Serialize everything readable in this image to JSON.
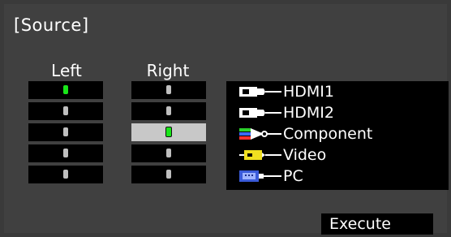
{
  "header": {
    "title": "[Source]"
  },
  "columns": {
    "left_label": "Left",
    "right_label": "Right"
  },
  "left_rows": [
    {
      "active": true,
      "selected": false
    },
    {
      "active": false,
      "selected": false
    },
    {
      "active": false,
      "selected": false
    },
    {
      "active": false,
      "selected": false
    },
    {
      "active": false,
      "selected": false
    }
  ],
  "right_rows": [
    {
      "active": false,
      "selected": false
    },
    {
      "active": false,
      "selected": false
    },
    {
      "active": true,
      "selected": true
    },
    {
      "active": false,
      "selected": false
    },
    {
      "active": false,
      "selected": false
    }
  ],
  "sources": [
    {
      "label": "HDMI1",
      "icon": "hdmi-cable-icon"
    },
    {
      "label": "HDMI2",
      "icon": "hdmi-cable-icon"
    },
    {
      "label": "Component",
      "icon": "component-cable-icon"
    },
    {
      "label": "Video",
      "icon": "video-cable-icon"
    },
    {
      "label": "PC",
      "icon": "vga-cable-icon"
    }
  ],
  "actions": {
    "execute_label": "Execute"
  },
  "colors": {
    "active_led": "#19e619",
    "idle_led": "#bfbfbf",
    "selected_cell": "#c8c8c8"
  }
}
